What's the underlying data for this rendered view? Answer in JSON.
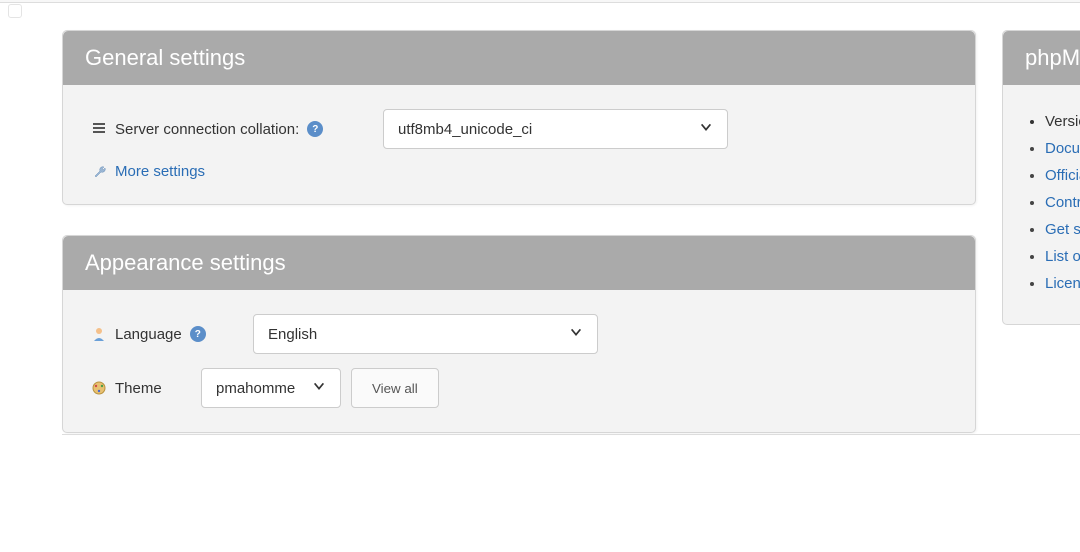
{
  "general": {
    "title": "General settings",
    "collation_label": "Server connection collation:",
    "collation_value": "utf8mb4_unicode_ci",
    "more_settings": "More settings"
  },
  "appearance": {
    "title": "Appearance settings",
    "language_label": "Language",
    "language_value": "English",
    "theme_label": "Theme",
    "theme_value": "pmahomme",
    "view_all": "View all"
  },
  "sidebar": {
    "title": "phpMyAdmin",
    "items": [
      {
        "label": "Version information:",
        "link": false
      },
      {
        "label": "Documentation",
        "link": true
      },
      {
        "label": "Official Homepage",
        "link": true
      },
      {
        "label": "Contribute",
        "link": true
      },
      {
        "label": "Get support",
        "link": true
      },
      {
        "label": "List of changes",
        "link": true
      },
      {
        "label": "License",
        "link": true
      }
    ]
  }
}
